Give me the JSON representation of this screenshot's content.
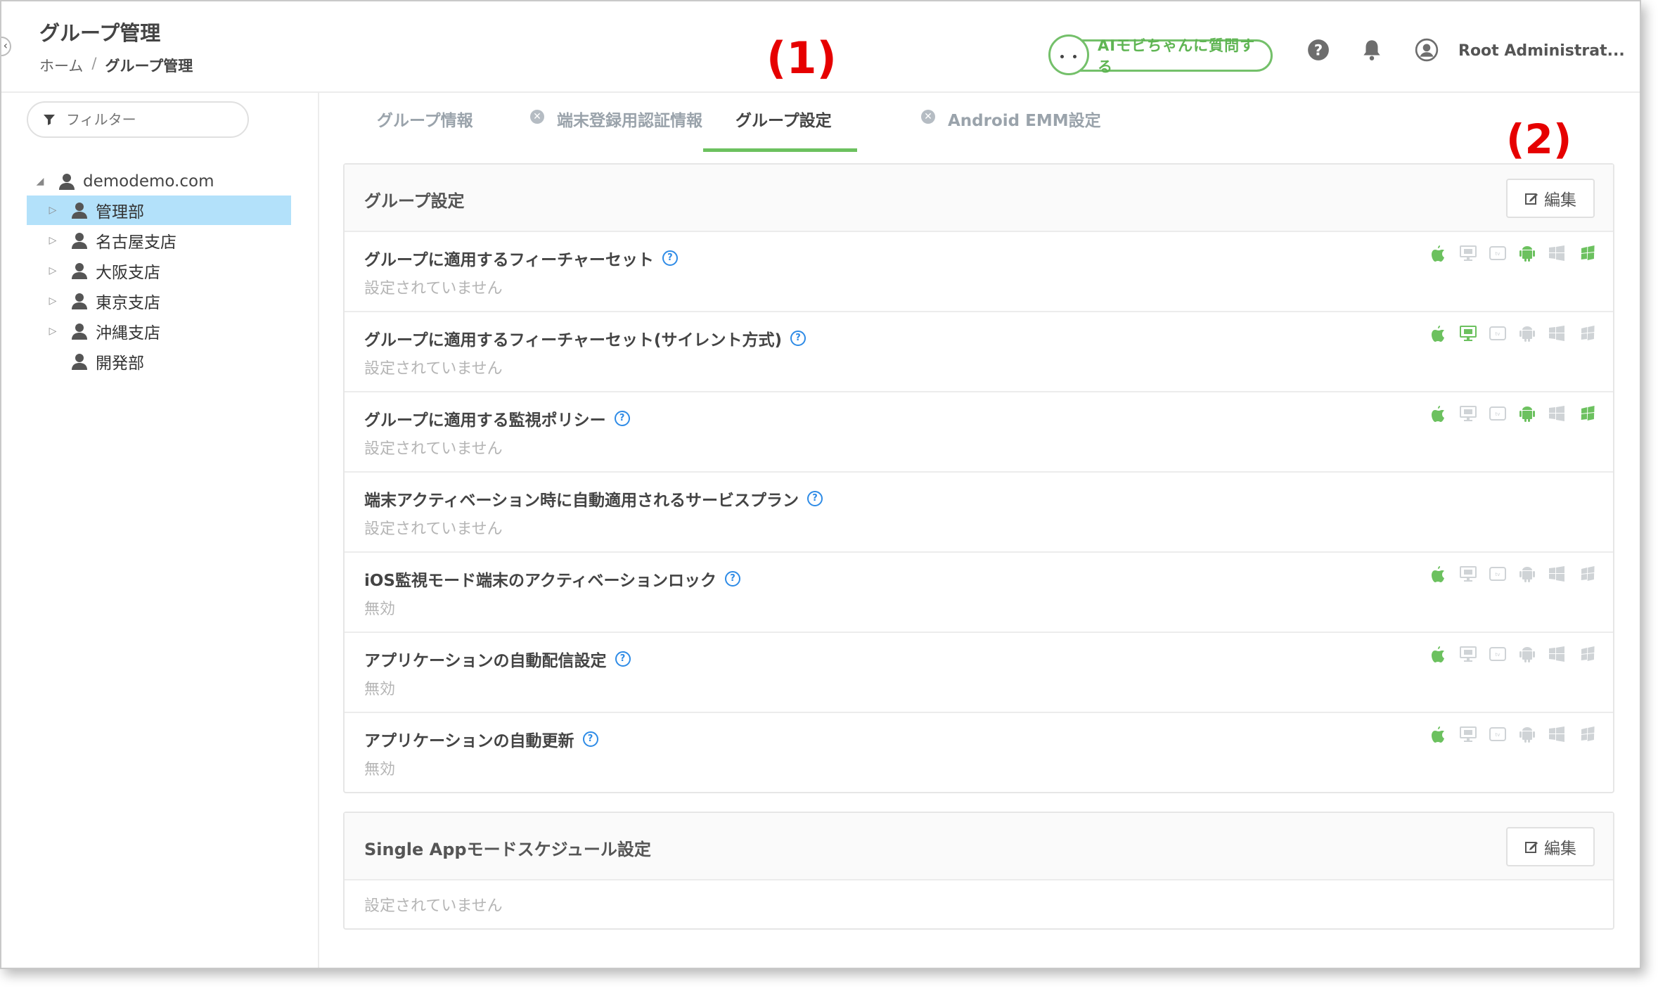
{
  "header": {
    "title": "グループ管理",
    "breadcrumb": [
      "ホーム",
      "/",
      "グループ管理"
    ],
    "ai_button": "AIモビちゃんに質問する",
    "user_name": "Root Administrat..."
  },
  "sidebar": {
    "filter_placeholder": "フィルター",
    "root": "demodemo.com",
    "items": [
      {
        "label": "管理部",
        "selected": true,
        "expandable": true
      },
      {
        "label": "名古屋支店",
        "selected": false,
        "expandable": true
      },
      {
        "label": "大阪支店",
        "selected": false,
        "expandable": true
      },
      {
        "label": "東京支店",
        "selected": false,
        "expandable": true
      },
      {
        "label": "沖縄支店",
        "selected": false,
        "expandable": true
      },
      {
        "label": "開発部",
        "selected": false,
        "expandable": false
      }
    ]
  },
  "tabs": [
    {
      "label": "グループ情報",
      "icon": null,
      "active": false
    },
    {
      "label": "端末登録用認証情報",
      "icon": "x-circle-icon",
      "active": false
    },
    {
      "label": "グループ設定",
      "icon": null,
      "active": true
    },
    {
      "label": "Android EMM設定",
      "icon": "x-circle-icon",
      "active": false
    }
  ],
  "annotations": {
    "one": "(1)",
    "two": "(2)"
  },
  "group_settings": {
    "title": "グループ設定",
    "edit_label": "編集",
    "rows": [
      {
        "label": "グループに適用するフィーチャーセット",
        "value": "設定されていません",
        "platforms": [
          1,
          0,
          0,
          1,
          0,
          1
        ]
      },
      {
        "label": "グループに適用するフィーチャーセット(サイレント方式)",
        "value": "設定されていません",
        "platforms": [
          1,
          1,
          0,
          0,
          0,
          0
        ]
      },
      {
        "label": "グループに適用する監視ポリシー",
        "value": "設定されていません",
        "platforms": [
          1,
          0,
          0,
          1,
          0,
          1
        ]
      },
      {
        "label": "端末アクティベーション時に自動適用されるサービスプラン",
        "value": "設定されていません",
        "platforms": null
      },
      {
        "label": "iOS監視モード端末のアクティベーションロック",
        "value": "無効",
        "platforms": [
          1,
          0,
          0,
          0,
          0,
          0
        ]
      },
      {
        "label": "アプリケーションの自動配信設定",
        "value": "無効",
        "platforms": [
          1,
          0,
          0,
          0,
          0,
          0
        ]
      },
      {
        "label": "アプリケーションの自動更新",
        "value": "無効",
        "platforms": [
          1,
          0,
          0,
          0,
          0,
          0
        ]
      }
    ]
  },
  "single_app": {
    "title": "Single Appモードスケジュール設定",
    "edit_label": "編集",
    "value": "設定されていません"
  },
  "colors": {
    "accent_green": "#6cc15f",
    "selected_bg": "#b3e1fa",
    "annotation_red": "#e60000",
    "help_blue": "#2e8be6",
    "inactive_gray": "#cfd3d6"
  }
}
